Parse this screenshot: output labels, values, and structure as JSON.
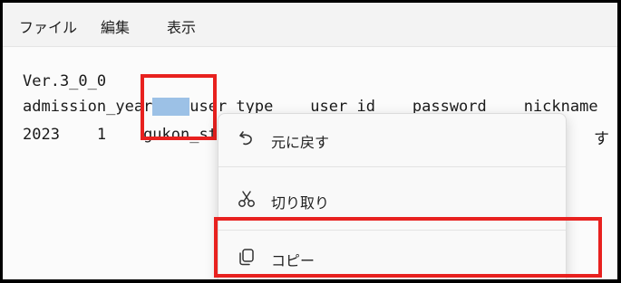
{
  "menubar": {
    "file": "ファイル",
    "edit": "編集",
    "view": "表示"
  },
  "editor": {
    "line1": "Ver.3_0_0",
    "line2": "admission_year\tuser_type\tuser_id\tpassword\tnickname",
    "line2_a": "admission_year",
    "line2_sel": "    ",
    "line2_b": "user_type    user_id    password    nickname",
    "line3_a": "2023    1    ",
    "line3_b": "gukon_st",
    "line3_tail": "す"
  },
  "context_menu": {
    "items": [
      {
        "label": "元に戻す",
        "icon": "undo-icon"
      },
      {
        "label": "切り取り",
        "icon": "scissors-icon"
      },
      {
        "label": "コピー",
        "icon": "copy-icon"
      }
    ]
  },
  "colors": {
    "highlight": "#e8211f",
    "selection": "#9cc1e6"
  }
}
